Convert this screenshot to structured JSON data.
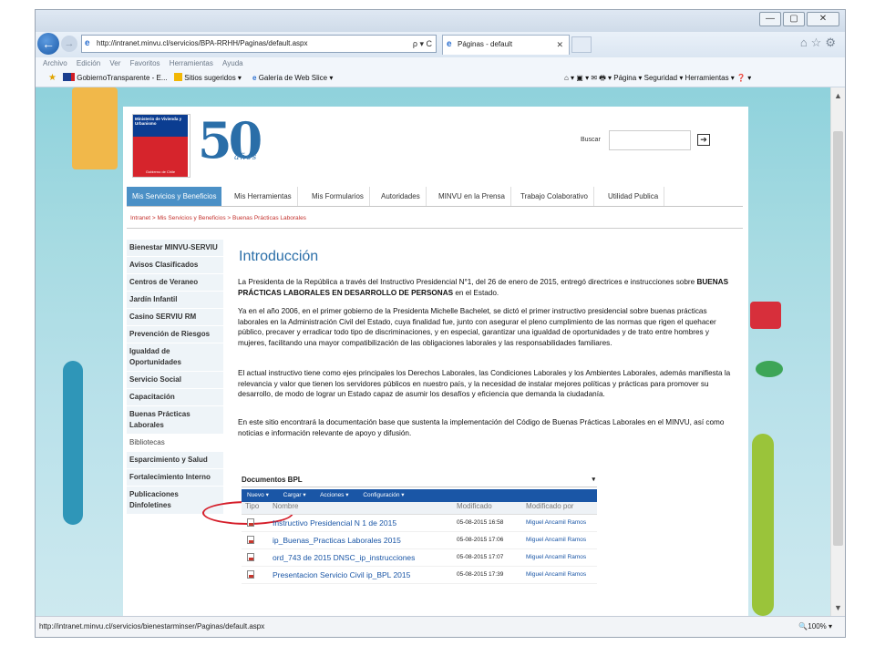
{
  "browser": {
    "url": "http://intranet.minvu.cl/servicios/BPA-RRHH/Paginas/default.aspx",
    "search_ctl": "ρ ▾ C",
    "tab_title": "Páginas - default",
    "menu": [
      "Archivo",
      "Edición",
      "Ver",
      "Favoritos",
      "Herramientas",
      "Ayuda"
    ],
    "favorites": [
      "GobiernoTransparente - E...",
      "Sitios sugeridos ▾",
      "Galería de Web Slice ▾"
    ],
    "commandbar": "⌂ ▾  ▣ ▾  ✉  🖶 ▾  Página ▾  Seguridad ▾  Herramientas ▾  ❓ ▾",
    "status_url": "http://intranet.minvu.cl/servicios/bienestarminser/Paginas/default.aspx",
    "zoom": "🔍100%  ▾",
    "tb_icons": "⌂☆⚙"
  },
  "header": {
    "logo_top": "Ministerio de Vivienda y Urbanismo",
    "logo_bottom": "Gobierno de Chile",
    "logo_50": "50",
    "logo_anos": "años",
    "search_label": "Buscar",
    "search_go": "➔"
  },
  "topnav": [
    "Mis Servicios y Beneficios",
    "Mis Herramientas",
    "Mis Formularios",
    "Autoridades",
    "MINVU en la Prensa",
    "Trabajo Colaborativo",
    "Utilidad Publica"
  ],
  "breadcrumb": "Intranet > Mis Servicios y Beneficios > Buenas Prácticas Laborales",
  "leftnav": [
    "Bienestar MINVU-SERVIU",
    "Avisos Clasificados",
    "Centros de Veraneo",
    "Jardín Infantil",
    "Casino SERVIU RM",
    "Prevención de Riesgos",
    "Igualdad de Oportunidades",
    "Servicio Social",
    "Capacitación",
    "Buenas Prácticas Laborales",
    "Bibliotecas",
    "Esparcimiento y Salud",
    "Fortalecimiento Interno",
    "Publicaciones Dinfoletines"
  ],
  "main": {
    "title": "Introducción",
    "p1_a": "La Presidenta de la República a través del Instructivo Presidencial N°1, del 26 de enero de 2015, entregó directrices e instrucciones sobre ",
    "p1_b": "BUENAS PRÁCTICAS LABORALES EN DESARROLLO DE PERSONAS",
    "p1_c": " en el Estado.",
    "p2": "Ya en el año 2006, en el primer gobierno de la Presidenta Michelle Bachelet, se dictó el primer instructivo presidencial sobre buenas prácticas laborales en la Administración Civil del Estado, cuya finalidad fue, junto con asegurar el pleno cumplimiento de las normas que rigen el quehacer público, precaver y erradicar todo tipo de discriminaciones, y en especial, garantizar una igualdad de oportunidades y de trato entre hombres y mujeres, facilitando una mayor compatibilización de las obligaciones laborales y las responsabilidades familiares.",
    "p3": "El actual instructivo tiene como ejes principales los Derechos Laborales, las Condiciones Laborales y los Ambientes Laborales, además manifiesta la relevancia y valor que tienen los servidores públicos en nuestro país, y la necesidad de instalar mejores políticas y prácticas para promover su desarrollo, de modo de lograr un Estado capaz de asumir los desafíos y eficiencia que demanda la ciudadanía.",
    "p4": "En este sitio encontrará la documentación base que sustenta la implementación del Código de Buenas Prácticas Laborales en el MINVU, así como noticias e información relevante de apoyo y difusión."
  },
  "docs": {
    "title": "Documentos BPL",
    "title_arrow": "▾",
    "toolbar": [
      "Nuevo ▾",
      "Cargar ▾",
      "Acciones ▾",
      "Configuración ▾"
    ],
    "headers": [
      "Tipo",
      "Nombre",
      "Modificado",
      "Modificado por"
    ],
    "rows": [
      {
        "name": "Instructivo Presidencial N 1 de 2015",
        "date": "05-08-2015 16:58",
        "by": "Miguel Ancamil Ramos"
      },
      {
        "name": "ip_Buenas_Practicas Laborales 2015",
        "date": "05-08-2015 17:06",
        "by": "Miguel Ancamil Ramos"
      },
      {
        "name": "ord_743 de 2015 DNSC_ip_instrucciones",
        "date": "05-08-2015 17:07",
        "by": "Miguel Ancamil Ramos"
      },
      {
        "name": "Presentacion Servicio Civil ip_BPL 2015",
        "date": "05-08-2015 17:39",
        "by": "Miguel Ancamil Ramos"
      }
    ]
  },
  "scroll": {
    "up": "▲",
    "down": "▼"
  },
  "colors": {
    "accent_blue": "#2a6ea8",
    "nav_active": "#4b90c6",
    "highlight_red": "#d51e2a"
  }
}
